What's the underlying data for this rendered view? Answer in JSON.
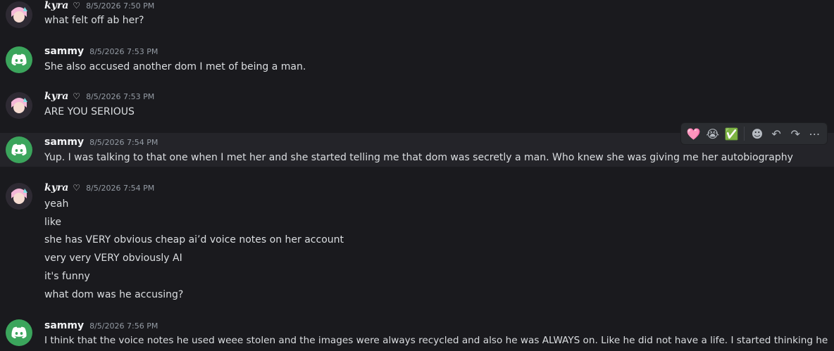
{
  "messages": [
    {
      "author": "kyra",
      "badge": "♡",
      "time": "8/5/2026 7:50 PM",
      "lines": [
        "what felt off ab her?"
      ]
    },
    {
      "author": "sammy",
      "badge": "",
      "time": "8/5/2026 7:53 PM",
      "lines": [
        "She also accused another dom I met of being a man."
      ]
    },
    {
      "author": "kyra",
      "badge": "♡",
      "time": "8/5/2026 7:53 PM",
      "lines": [
        "ARE YOU SERIOUS"
      ]
    },
    {
      "author": "sammy",
      "badge": "",
      "time": "8/5/2026 7:54 PM",
      "lines": [
        "Yup.  I was talking to that one when I met her and she started telling me that dom was secretly a man.  Who knew she was giving me her autobiography"
      ]
    },
    {
      "author": "kyra",
      "badge": "♡",
      "time": "8/5/2026 7:54 PM",
      "lines": [
        "yeah",
        "like",
        "she has VERY obvious cheap ai’d voice notes on her account",
        "very very VERY obviously AI",
        "it's funny",
        "what dom was he accusing?"
      ]
    },
    {
      "author": "sammy",
      "badge": "",
      "time": "8/5/2026 7:56 PM",
      "lines": [
        "I think that the voice notes he used weee stolen and the images were always recycled and also he was ALWAYS on.  Like he did not have a life.  I started thinking he"
      ]
    }
  ],
  "toolbar": {
    "reactions": [
      "🩷",
      "😭",
      "✅"
    ],
    "actions": [
      {
        "icon": "add-reaction-icon",
        "glyph": "☻"
      },
      {
        "icon": "reply-icon",
        "glyph": "↶"
      },
      {
        "icon": "forward-icon",
        "glyph": "↷"
      },
      {
        "icon": "more-icon",
        "glyph": "⋯"
      }
    ]
  },
  "colors": {
    "background": "#1a1a1e",
    "hover": "#242429",
    "discord_green": "#3ba55c",
    "timestamp": "#949ba4"
  }
}
